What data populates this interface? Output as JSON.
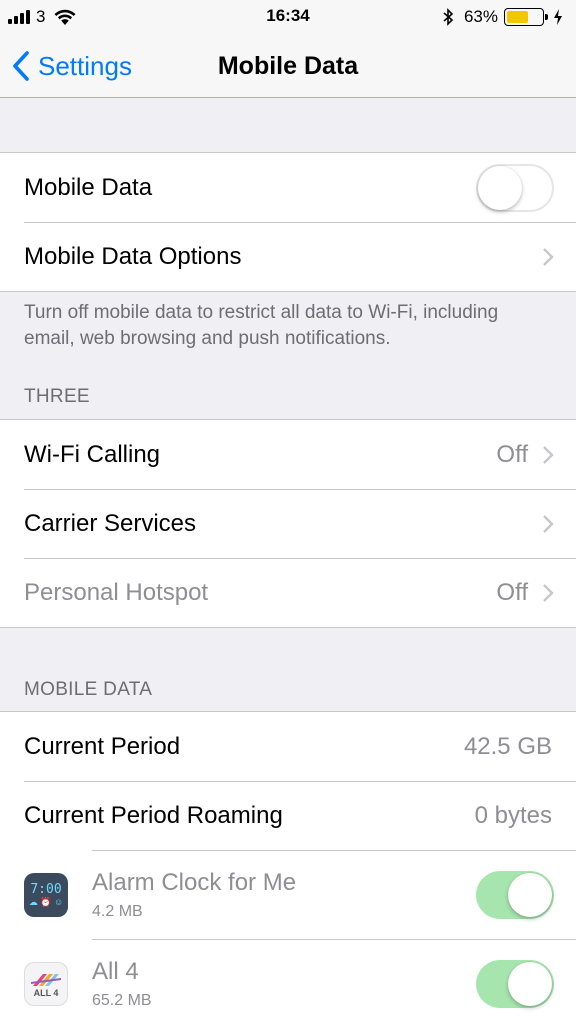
{
  "status_bar": {
    "carrier": "3",
    "time": "16:34",
    "battery_percent": "63%",
    "battery_level": 0.63,
    "battery_color": "#f3c700"
  },
  "nav": {
    "back_label": "Settings",
    "title": "Mobile Data",
    "accent_color": "#007aff"
  },
  "section1": {
    "mobile_data_label": "Mobile Data",
    "mobile_data_switch": "off",
    "options_label": "Mobile Data Options",
    "footer": "Turn off mobile data to restrict all data to Wi-Fi, including email, web browsing and push notifications."
  },
  "section2": {
    "header": "THREE",
    "rows": [
      {
        "label": "Wi-Fi Calling",
        "value": "Off"
      },
      {
        "label": "Carrier Services",
        "value": ""
      },
      {
        "label": "Personal Hotspot",
        "value": "Off",
        "disabled": true
      }
    ]
  },
  "section3": {
    "header": "MOBILE DATA",
    "current_period_label": "Current Period",
    "current_period_value": "42.5 GB",
    "roaming_label": "Current Period Roaming",
    "roaming_value": "0 bytes",
    "apps": [
      {
        "name": "Alarm Clock for Me",
        "size": "4.2 MB",
        "icon": "alarm-clock-app-icon",
        "switch": "on"
      },
      {
        "name": "All 4",
        "size": "65.2 MB",
        "icon": "all4-app-icon",
        "switch": "on"
      }
    ],
    "icon_text": {
      "alarm_time": "7:00",
      "all4": "ALL 4"
    },
    "switch_on_color": "#a6e6ae"
  }
}
